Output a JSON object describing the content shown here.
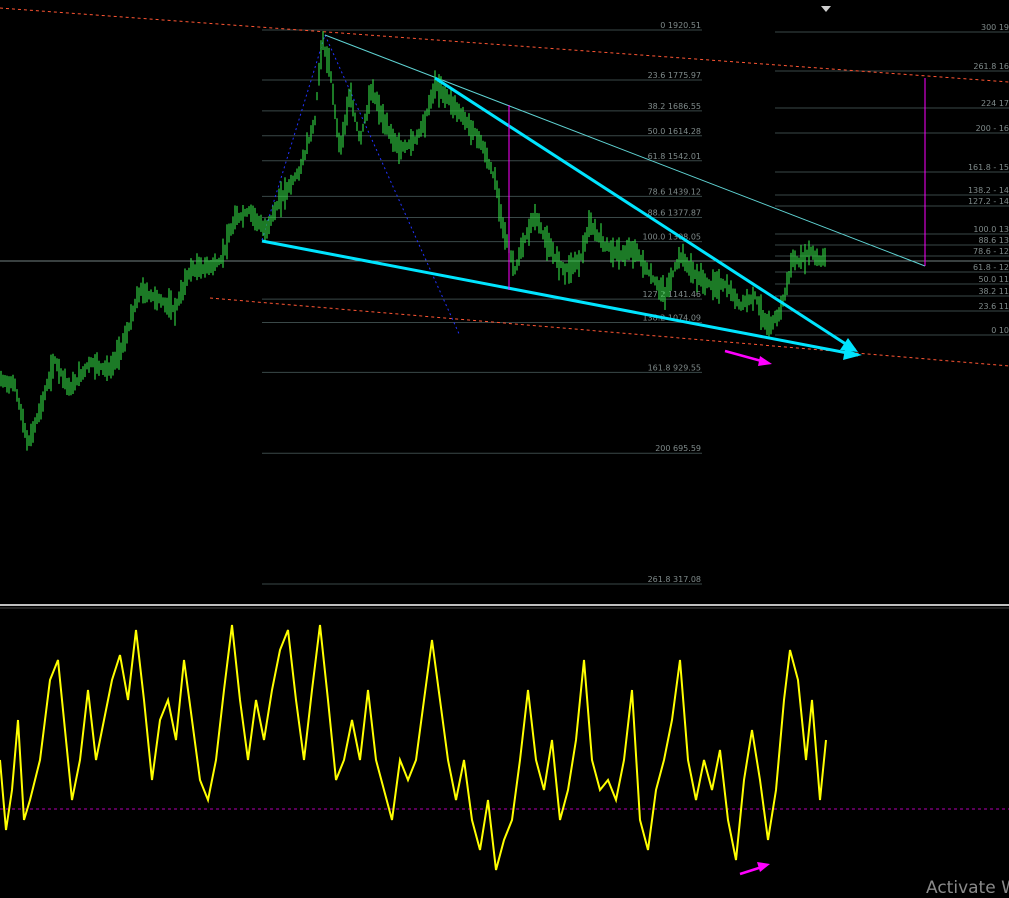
{
  "chart_data": {
    "type": "line",
    "panels": [
      {
        "name": "price",
        "style": "candles",
        "color": "#2ecc40",
        "xlim": [
          0,
          830
        ],
        "ylim": [
          0,
          604
        ],
        "series": [],
        "fib_retracement_left": [
          {
            "ratio": "0",
            "price": "1920.51"
          },
          {
            "ratio": "23.6",
            "price": "1775.97"
          },
          {
            "ratio": "38.2",
            "price": "1686.55"
          },
          {
            "ratio": "50.0",
            "price": "1614.28"
          },
          {
            "ratio": "61.8",
            "price": "1542.01"
          },
          {
            "ratio": "78.6",
            "price": "1439.12"
          },
          {
            "ratio": "88.6",
            "price": "1377.87"
          },
          {
            "ratio": "100.0",
            "price": "1308.05"
          },
          {
            "ratio": "127.2",
            "price": "1141.46"
          },
          {
            "ratio": "138.2",
            "price": "1074.09"
          },
          {
            "ratio": "161.8",
            "price": "929.55"
          },
          {
            "ratio": "200",
            "price": "695.59"
          },
          {
            "ratio": "261.8",
            "price": "317.08"
          }
        ],
        "fib_right_labels": [
          "300 19",
          "261.8 16",
          "224 17",
          "200 - 16",
          "161.8 - 15",
          "138.2 - 14",
          "127.2 - 14",
          "100.0 13",
          "88.6 13",
          "78.6 - 12",
          "61.8 - 12",
          "50.0 11",
          "38.2 11",
          "23.6 11",
          "0 10"
        ]
      },
      {
        "name": "oscillator",
        "color": "#ffff00",
        "ylim": [
          0,
          1
        ],
        "series": []
      }
    ],
    "annotations": [
      {
        "type": "trendline",
        "color": "#00e5ff"
      },
      {
        "type": "arrow",
        "color": "#ff00ff"
      }
    ]
  },
  "watermark": "Activate W"
}
